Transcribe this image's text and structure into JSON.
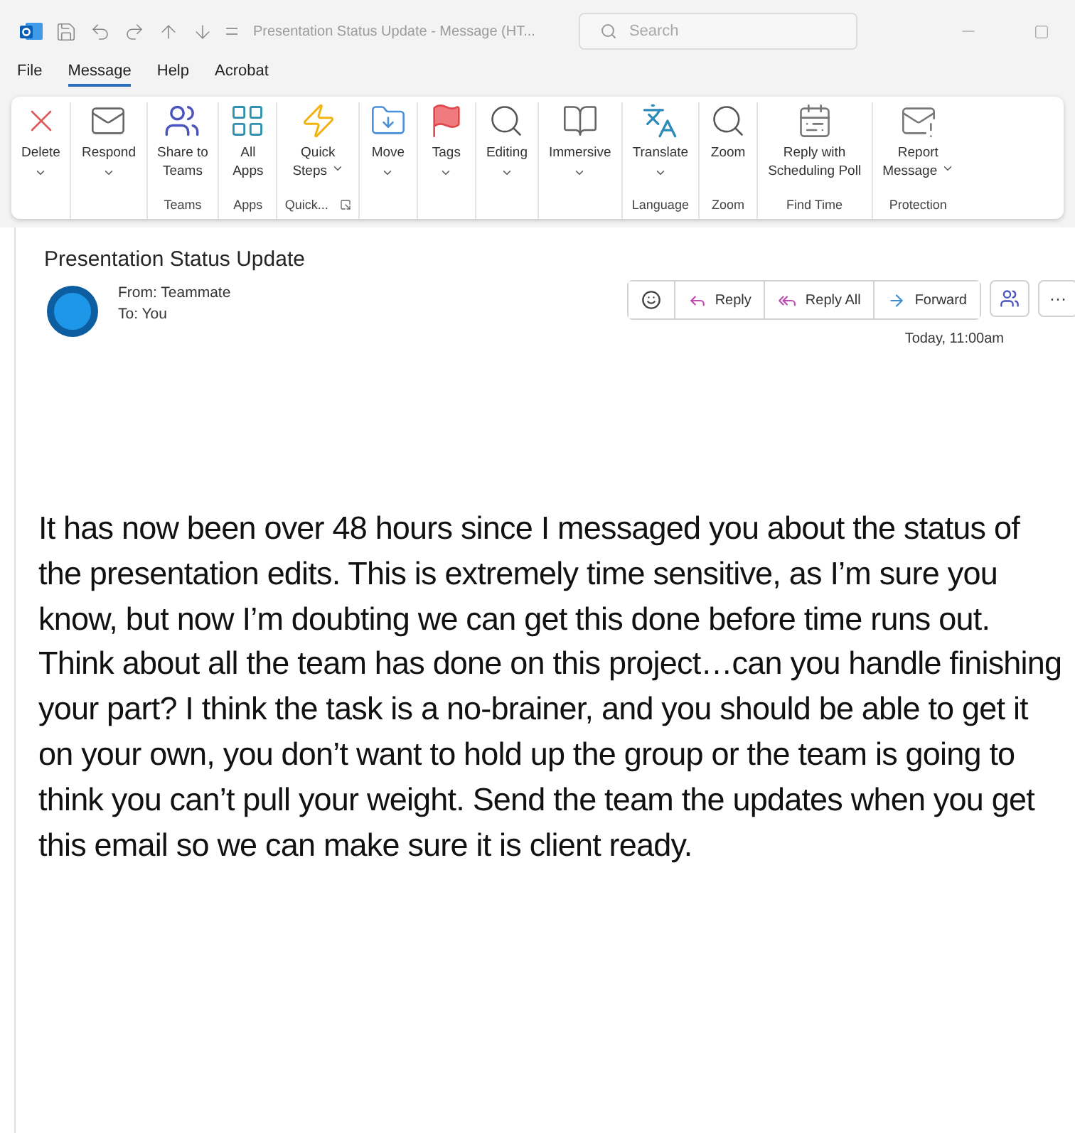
{
  "window": {
    "title": "Presentation Status Update  -  Message (HT...",
    "search": {
      "placeholder": "Search"
    }
  },
  "menu": [
    {
      "label": "File",
      "selected": false
    },
    {
      "label": "Message",
      "selected": true
    },
    {
      "label": "Help",
      "selected": false
    },
    {
      "label": "Acrobat",
      "selected": false
    }
  ],
  "ribbon": [
    {
      "items": [
        {
          "lines": [
            "Delete"
          ],
          "dropdown": true
        }
      ]
    },
    {
      "items": [
        {
          "lines": [
            "Respond"
          ],
          "dropdown": true
        }
      ]
    },
    {
      "group": "Teams",
      "items": [
        {
          "lines": [
            "Share to",
            "Teams"
          ],
          "dropdown": false
        }
      ]
    },
    {
      "group": "Apps",
      "items": [
        {
          "lines": [
            "All",
            "Apps"
          ],
          "dropdown": false
        }
      ]
    },
    {
      "group": "Quick...",
      "launcher": true,
      "items": [
        {
          "lines": [
            "Quick",
            "Steps"
          ],
          "dropdown": true
        }
      ]
    },
    {
      "items": [
        {
          "lines": [
            "Move"
          ],
          "dropdown": true
        }
      ]
    },
    {
      "items": [
        {
          "lines": [
            "Tags"
          ],
          "dropdown": true
        }
      ]
    },
    {
      "items": [
        {
          "lines": [
            "Editing"
          ],
          "dropdown": true
        }
      ]
    },
    {
      "items": [
        {
          "lines": [
            "Immersive"
          ],
          "dropdown": true
        }
      ]
    },
    {
      "group": "Language",
      "items": [
        {
          "lines": [
            "Translate"
          ],
          "dropdown": true
        }
      ]
    },
    {
      "group": "Zoom",
      "items": [
        {
          "lines": [
            "Zoom"
          ],
          "dropdown": false
        }
      ]
    },
    {
      "group": "Find Time",
      "items": [
        {
          "lines": [
            "Reply with",
            "Scheduling Poll"
          ],
          "dropdown": false
        }
      ]
    },
    {
      "group": "Protection",
      "items": [
        {
          "lines": [
            "Report",
            "Message"
          ],
          "dropdown": true
        }
      ]
    }
  ],
  "message": {
    "subject": "Presentation Status Update",
    "from": "From: Teammate",
    "to": "To: You",
    "actions": [
      "Reply",
      "Reply All",
      "Forward"
    ],
    "more": "···",
    "date": "Today, 11:00am",
    "body": "It has now been over 48 hours since I messaged you about the status of the presentation edits. This is extremely time sensitive, as I’m sure you know, but now I’m doubting we can get this done before time runs out. Think about all the team has done on this project…can you handle finishing your part? I think the task is a no-brainer, and you should be able to get it on your own, you don’t want to hold up the group or the team is going to think you can’t pull your weight. Send the team the updates when you get this email so we can make sure it is client ready."
  }
}
